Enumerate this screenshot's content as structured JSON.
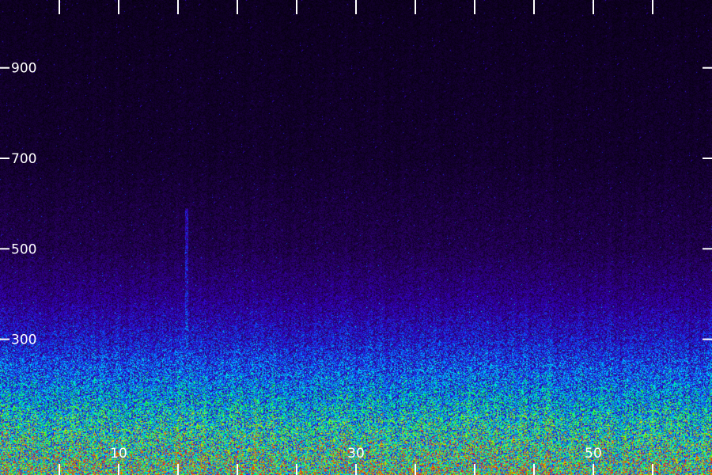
{
  "chart_data": {
    "type": "heatmap",
    "title": "",
    "xlabel": "",
    "ylabel": "",
    "xlim": [
      0,
      60
    ],
    "ylim": [
      0,
      1050
    ],
    "x_ticks": [
      0,
      5,
      10,
      15,
      20,
      25,
      30,
      35,
      40,
      45,
      50,
      55
    ],
    "x_tick_labels": [
      {
        "value": 10,
        "label": "10"
      },
      {
        "value": 30,
        "label": "30"
      },
      {
        "value": 50,
        "label": "50"
      }
    ],
    "y_ticks": [
      {
        "value": 300,
        "label": "300"
      },
      {
        "value": 500,
        "label": "500"
      },
      {
        "value": 700,
        "label": "700"
      },
      {
        "value": 900,
        "label": "900"
      }
    ],
    "colormap": [
      "#000000",
      "#2a0066",
      "#3300cc",
      "#0066ff",
      "#00e6ff",
      "#00ff33",
      "#ccff00",
      "#ff3300"
    ],
    "energy_profile": [
      {
        "frequency": 0,
        "level": 0.8
      },
      {
        "frequency": 100,
        "level": 0.65
      },
      {
        "frequency": 200,
        "level": 0.48
      },
      {
        "frequency": 300,
        "level": 0.32
      },
      {
        "frequency": 400,
        "level": 0.2
      },
      {
        "frequency": 500,
        "level": 0.12
      },
      {
        "frequency": 700,
        "level": 0.07
      },
      {
        "frequency": 1050,
        "level": 0.05
      }
    ],
    "events": [
      {
        "x": 15.7,
        "freq_max": 590,
        "level": 0.22,
        "type": "vertical-streak"
      },
      {
        "x": 32,
        "freq_max": 90,
        "level": 0.95,
        "type": "hotspot"
      },
      {
        "x": 35,
        "freq_max": 70,
        "level": 0.98,
        "type": "hotspot"
      },
      {
        "x": 43,
        "freq_max": 60,
        "level": 0.9,
        "type": "hotspot"
      }
    ]
  }
}
